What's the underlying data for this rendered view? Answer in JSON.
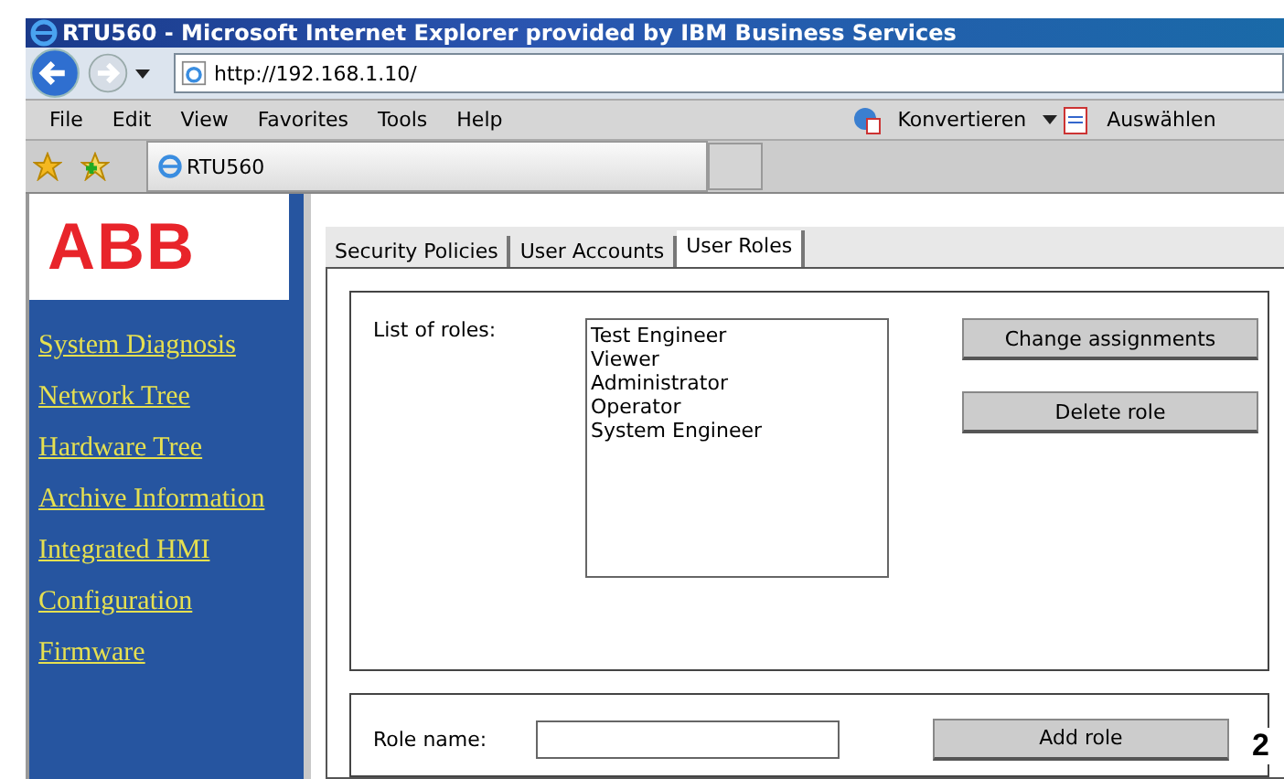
{
  "window": {
    "title": "RTU560 - Microsoft Internet Explorer provided by IBM Business Services"
  },
  "address_bar": {
    "value": "http://192.168.1.10/"
  },
  "menu": [
    "File",
    "Edit",
    "View",
    "Favorites",
    "Tools",
    "Help"
  ],
  "toolbar": {
    "convert": "Konvertieren",
    "select": "Auswählen"
  },
  "browser_tab": {
    "title": "RTU560"
  },
  "sidebar": {
    "logo": "ABB",
    "items": [
      {
        "label": "System Diagnosis"
      },
      {
        "label": "Network Tree"
      },
      {
        "label": "Hardware Tree"
      },
      {
        "label": "Archive Information"
      },
      {
        "label": "Integrated HMI"
      },
      {
        "label": "Configuration"
      },
      {
        "label": "Firmware"
      }
    ]
  },
  "tabs": [
    {
      "label": "Security Policies",
      "selected": false
    },
    {
      "label": "User Accounts",
      "selected": false
    },
    {
      "label": "User Roles",
      "selected": true
    }
  ],
  "roles_panel": {
    "label": "List of roles:",
    "roles": [
      "Test Engineer",
      "Viewer",
      "Administrator",
      "Operator",
      "System Engineer"
    ],
    "buttons": [
      "Change assignments",
      "Delete role"
    ]
  },
  "add_panel": {
    "label": "Role name:",
    "button": "Add role"
  },
  "callout": "2"
}
